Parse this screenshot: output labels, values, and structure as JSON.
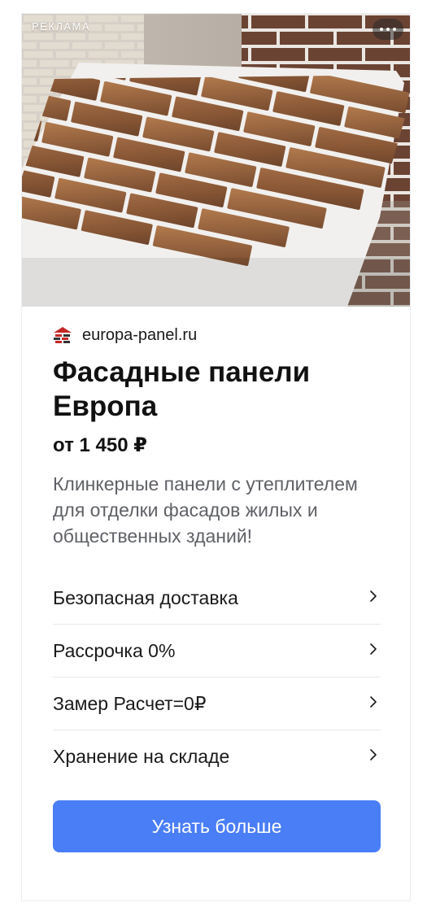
{
  "ad": {
    "label": "РЕКЛАМА",
    "domain": "europa-panel.ru",
    "title": "Фасадные панели Европа",
    "price": "от 1 450 ₽",
    "description": "Клинкерные панели с утеплителем для отделки фасадов жилых и общественных зданий!",
    "sitelinks": [
      {
        "label": "Безопасная доставка"
      },
      {
        "label": "Рассрочка 0%"
      },
      {
        "label": "Замер Расчет=0₽"
      },
      {
        "label": "Хранение на складе"
      }
    ],
    "cta_label": "Узнать больше",
    "image_subject": "facade-panels-brick-image",
    "icons": {
      "more": "more-dots-icon",
      "favicon": "europa-panel-logo-icon",
      "chevron": "chevron-right-icon"
    },
    "colors": {
      "cta": "#4a7ef6",
      "text": "#111111",
      "secondary_text": "#5f6166",
      "divider": "#e7e8ea"
    }
  }
}
